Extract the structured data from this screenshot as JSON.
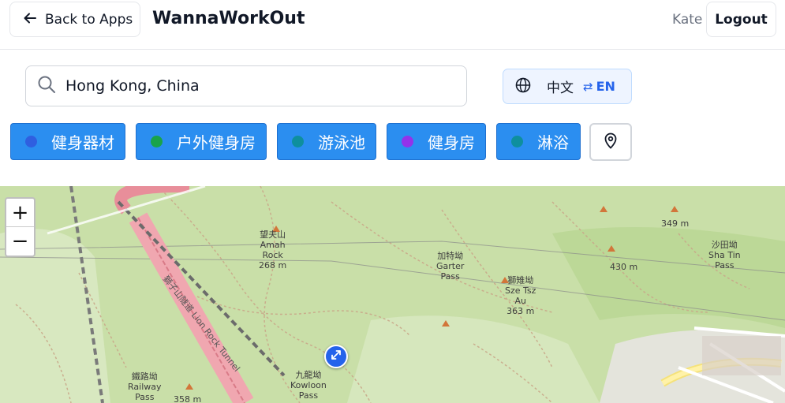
{
  "header": {
    "back_label": "Back to Apps",
    "app_title": "WannaWorkOut",
    "user_name": "Kate",
    "logout_label": "Logout"
  },
  "search": {
    "value": "Hong Kong, China",
    "icon": "search-icon"
  },
  "language": {
    "current": "中文",
    "swap_symbol": "⇄",
    "other": "EN",
    "icon": "globe-icon"
  },
  "filters": [
    {
      "label": "健身器材",
      "dot_color": "#2f5fe0"
    },
    {
      "label": "户外健身房",
      "dot_color": "#19a34a"
    },
    {
      "label": "游泳池",
      "dot_color": "#0e8f9e"
    },
    {
      "label": "健身房",
      "dot_color": "#9333ea"
    },
    {
      "label": "淋浴",
      "dot_color": "#0e8f9e"
    }
  ],
  "location_button_icon": "map-pin-icon",
  "map": {
    "zoom_in": "+",
    "zoom_out": "−",
    "labels": [
      {
        "text": "望夫山\nAmah\nRock\n268 m"
      },
      {
        "text": "加特坳\nGarter\nPass"
      },
      {
        "text": "獅雉坳\nSze Tsz\nAu\n363 m"
      },
      {
        "text": "沙田坳\nSha Tin\nPass"
      },
      {
        "text": "349 m"
      },
      {
        "text": "430 m"
      },
      {
        "text": "九龍坳\nKowloon\nPass"
      },
      {
        "text": "鐵路坳\nRailway\nPass"
      },
      {
        "text": "358 m"
      },
      {
        "text": "獅子山隧道 Lion Rock Tunnel"
      }
    ]
  },
  "colors": {
    "accent": "#2b8ef0",
    "primary_text": "#111827",
    "muted_text": "#6b7280",
    "link_blue": "#2563eb"
  }
}
